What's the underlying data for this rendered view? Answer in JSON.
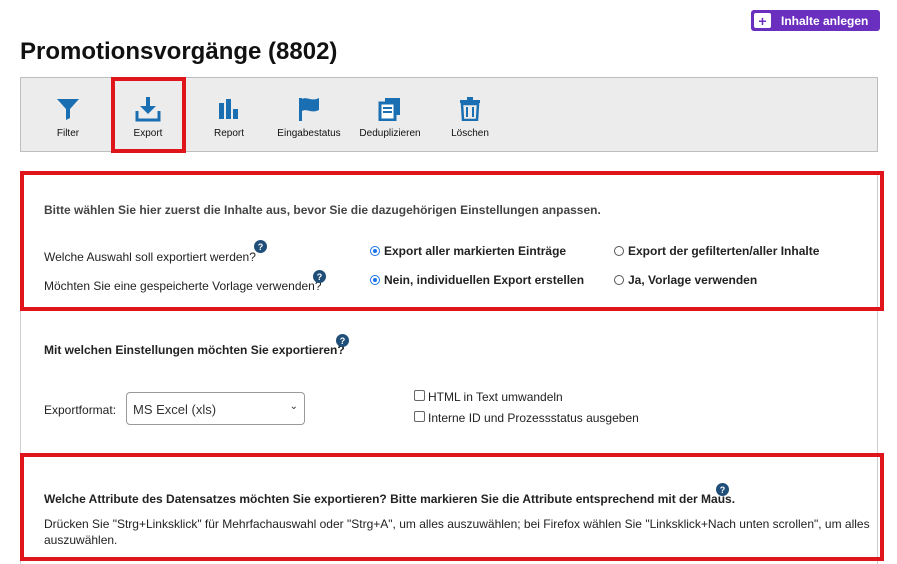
{
  "header": {
    "add_button_label": "Inhalte anlegen",
    "page_title": "Promotionsvorgänge (8802)"
  },
  "toolbar": [
    {
      "label": "Filter",
      "icon": "filter-icon"
    },
    {
      "label": "Export",
      "icon": "download-icon"
    },
    {
      "label": "Report",
      "icon": "bar-chart-icon"
    },
    {
      "label": "Eingabestatus",
      "icon": "flag-icon"
    },
    {
      "label": "Deduplizieren",
      "icon": "duplicate-icon"
    },
    {
      "label": "Löschen",
      "icon": "trash-icon"
    }
  ],
  "selection": {
    "intro": "Bitte wählen Sie hier zuerst die Inhalte aus, bevor Sie die dazugehörigen Einstellungen anpassen.",
    "q1": "Welche Auswahl soll exportiert werden?",
    "q1_opt1": "Export aller markierten Einträge",
    "q1_opt2": "Export der gefilterten/aller Inhalte",
    "q2": "Möchten Sie eine gespeicherte Vorlage verwenden?",
    "q2_opt1": "Nein, individuellen Export erstellen",
    "q2_opt2": "Ja, Vorlage verwenden"
  },
  "settings": {
    "heading": "Mit welchen Einstellungen möchten Sie exportieren?",
    "format_label": "Exportformat:",
    "format_value": "MS Excel (xls)",
    "cb_html": "HTML in Text umwandeln",
    "cb_ids": "Interne ID und Prozessstatus ausgeben"
  },
  "attributes": {
    "heading": "Welche Attribute des Datensatzes möchten Sie exportieren? Bitte markieren Sie die Attribute entsprechend mit der Maus.",
    "hint_line1": "Drücken Sie \"Strg+Linksklick\" für Mehrfachauswahl oder \"Strg+A\", um alles auszuwählen; bei Firefox wählen Sie \"Linksklick+Nach unten scrollen\", um alles",
    "hint_line2": "auszuwählen."
  },
  "help_glyph": "?",
  "colors": {
    "accent": "#6a2fbf",
    "icon_blue": "#1a6fb3",
    "highlight": "#e0141b",
    "help": "#1f4e79"
  }
}
